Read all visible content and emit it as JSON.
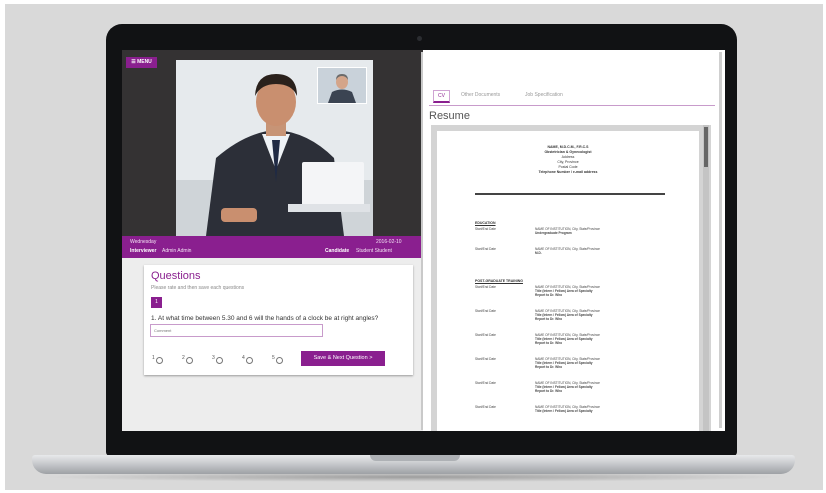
{
  "menu_label": "MENU",
  "interview": {
    "day": "Wednesday",
    "date": "2016-02-10",
    "interviewer_label": "Interviewer",
    "interviewer_name": "Admin Admin",
    "candidate_label": "Candidate",
    "candidate_name": "Student Student"
  },
  "questions": {
    "title": "Questions",
    "instructions": "Please rate and then save each questions",
    "current_number": "1",
    "question_text": "1. At what time between 5.30 and 6 will the hands of a clock be at right angles?",
    "comment_placeholder": "Comment",
    "ratings": [
      "1",
      "2",
      "3",
      "4",
      "5"
    ],
    "save_label": "Save & Next Question >"
  },
  "tabs": [
    {
      "label": "CV",
      "active": true
    },
    {
      "label": "Other Documents",
      "active": false
    },
    {
      "label": "Job Specification",
      "active": false
    }
  ],
  "resume": {
    "heading": "Resume",
    "name_line": "NAME, M.D.C.M., F.R.C.S",
    "specialty": "Obstetrician & Gynecologist",
    "address": "Address",
    "city": "City, Province",
    "postal": "Postal Code",
    "contact": "Telephone   Number / e-mail   address",
    "sections": [
      {
        "title": "EDUCATION",
        "rows": [
          {
            "date": "Start/End Date",
            "lines": [
              "NAME OF INSTITUTION, City, State/Province",
              "Undergraduate Program"
            ]
          },
          {
            "date": "Start/End Date",
            "lines": [
              "NAME OF INSTITUTION, City, State/Province",
              "M.D."
            ]
          }
        ]
      },
      {
        "title": "POST-GRADUATE TRAINING",
        "rows": [
          {
            "date": "Start/End Date",
            "lines": [
              "NAME OF INSTITUTION, City, State/Province",
              "Title (Intern / Fellow) Area of Specialty",
              "Report to Dr. Who"
            ]
          },
          {
            "date": "Start/End Date",
            "lines": [
              "NAME OF INSTITUTION, City, State/Province",
              "Title (Intern / Fellow) Area of Specialty",
              "Report to Dr. Who"
            ]
          },
          {
            "date": "Start/End Date",
            "lines": [
              "NAME OF INSTITUTION, City, State/Province",
              "Title (Intern / Fellow) Area of Specialty",
              "Report to Dr. Who"
            ]
          },
          {
            "date": "Start/End Date",
            "lines": [
              "NAME OF INSTITUTION, City, State/Province",
              "Title (Intern / Fellow) Area of Specialty",
              "Report to Dr. Who"
            ]
          },
          {
            "date": "Start/End Date",
            "lines": [
              "NAME OF INSTITUTION, City, State/Province",
              "Title (Intern / Fellow) Area of Specialty",
              "Report to Dr. Who"
            ]
          },
          {
            "date": "Start/End Date",
            "lines": [
              "NAME OF INSTITUTION, City, State/Province",
              "Title (Intern / Fellow) Area of Specialty"
            ]
          }
        ]
      }
    ]
  },
  "colors": {
    "accent": "#8a1f8f",
    "video_background": "#343233",
    "bezel": "#111214"
  }
}
